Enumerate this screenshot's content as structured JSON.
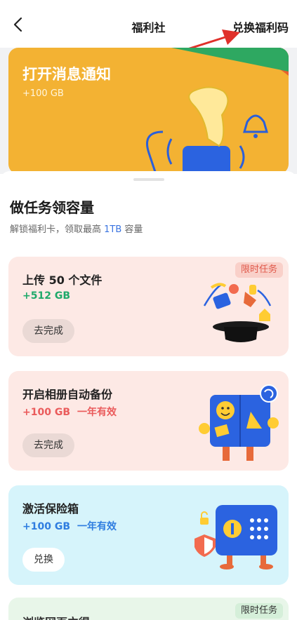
{
  "header": {
    "title": "福利社",
    "redeem_label": "兑换福利码"
  },
  "banner": {
    "title": "打开消息通知",
    "reward": "+100 GB"
  },
  "tasks_section": {
    "title": "做任务领容量",
    "subtitle_prefix": "解锁福利卡，领取最高 ",
    "subtitle_highlight": "1TB",
    "subtitle_suffix": " 容量"
  },
  "tasks": [
    {
      "title": "上传 50 个文件",
      "reward": "+512 GB",
      "validity": "",
      "button": "去完成",
      "badge": "限时任务",
      "color": "#1fa96a"
    },
    {
      "title": "开启相册自动备份",
      "reward": "+100 GB",
      "validity": "一年有效",
      "button": "去完成",
      "badge": "",
      "color": "#ea5b5b"
    },
    {
      "title": "激活保险箱",
      "reward": "+100 GB",
      "validity": "一年有效",
      "button": "兑换",
      "badge": "",
      "color": "#2f7de0"
    }
  ],
  "peek_card": {
    "title": "浏览网页立得",
    "badge": "限时任务"
  },
  "colors": {
    "banner_bg": "#f3b233",
    "accent_blue": "#3a74e0",
    "pink_card": "#fde9e5",
    "cyan_card": "#d6f4fb",
    "annotation_arrow": "#e0302a"
  }
}
